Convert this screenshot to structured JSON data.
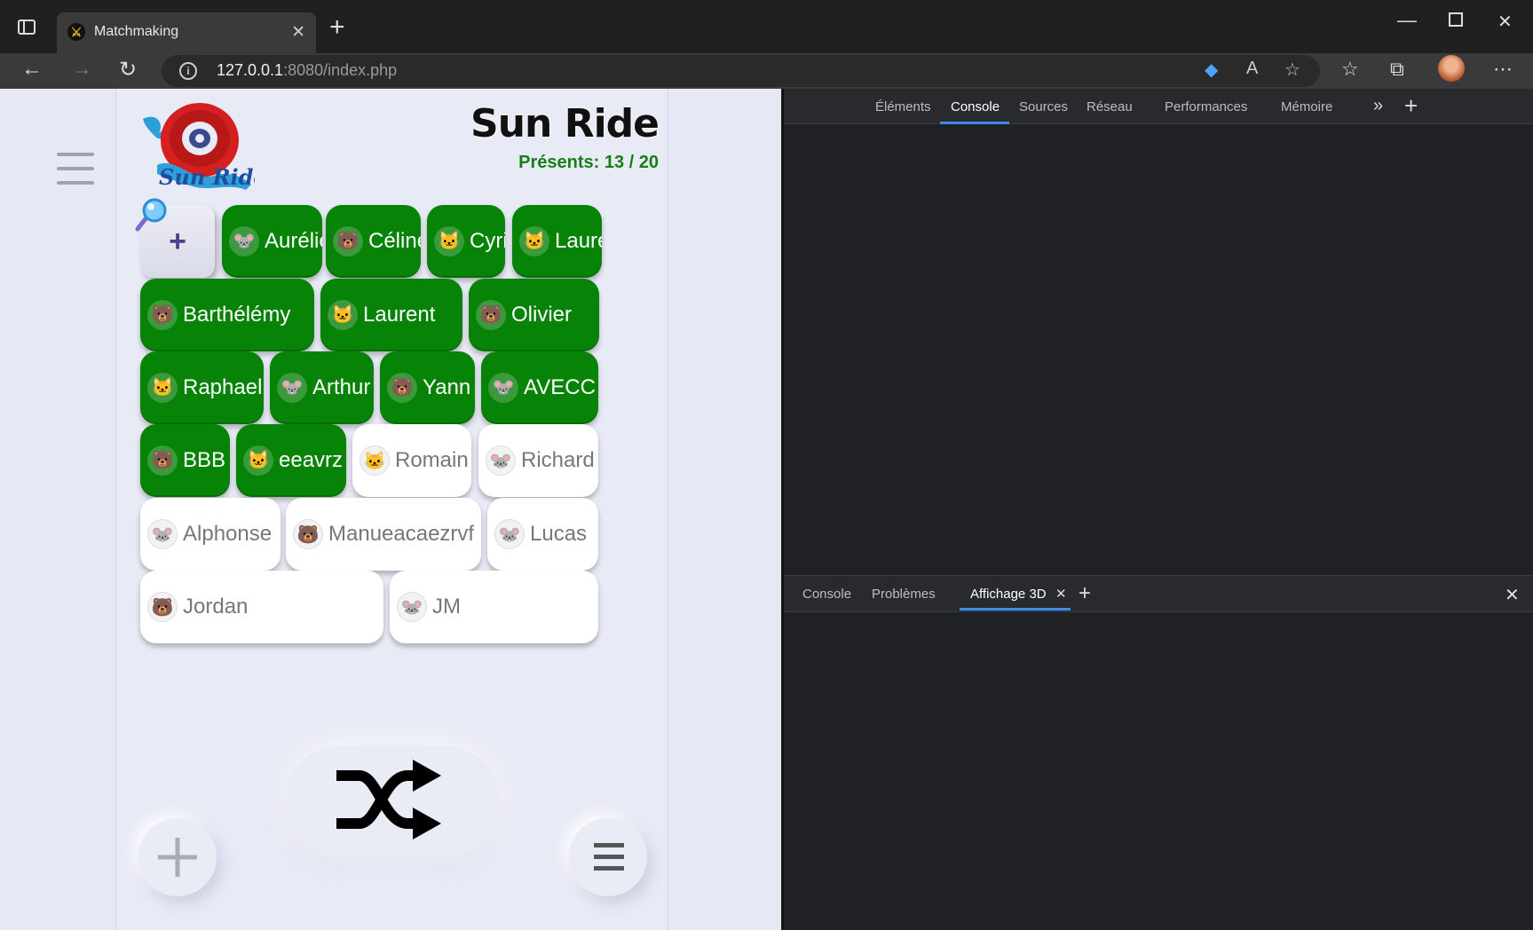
{
  "browser": {
    "tab_title": "Matchmaking",
    "url_host": "127.0.0.1",
    "url_rest": ":8080/index.php"
  },
  "app": {
    "brand": "Sun Ride",
    "present_label": "Présents: 13 / 20",
    "add_label": "+",
    "members": [
      {
        "name": "Aurélie",
        "icon": "mouse",
        "emoji": "🐭",
        "present": true
      },
      {
        "name": "Céline",
        "icon": "bear",
        "emoji": "🐻",
        "present": true
      },
      {
        "name": "Cyril",
        "icon": "cat",
        "emoji": "🐱",
        "present": true
      },
      {
        "name": "Laure",
        "icon": "cat",
        "emoji": "🐱",
        "present": true
      },
      {
        "name": "Barthélémy",
        "icon": "bear",
        "emoji": "🐻",
        "present": true
      },
      {
        "name": "Laurent",
        "icon": "cat",
        "emoji": "🐱",
        "present": true
      },
      {
        "name": "Olivier",
        "icon": "bear",
        "emoji": "🐻",
        "present": true
      },
      {
        "name": "Raphael",
        "icon": "cat",
        "emoji": "🐱",
        "present": true
      },
      {
        "name": "Arthur",
        "icon": "mouse",
        "emoji": "🐭",
        "present": true
      },
      {
        "name": "Yann",
        "icon": "bear",
        "emoji": "🐻",
        "present": true
      },
      {
        "name": "AVECC",
        "icon": "mouse",
        "emoji": "🐭",
        "present": true
      },
      {
        "name": "BBB",
        "icon": "bear",
        "emoji": "🐻",
        "present": true
      },
      {
        "name": "eeavrz",
        "icon": "cat",
        "emoji": "🐱",
        "present": true
      },
      {
        "name": "Romain",
        "icon": "cat",
        "emoji": "🐱",
        "present": false
      },
      {
        "name": "Richard",
        "icon": "mouse",
        "emoji": "🐭",
        "present": false
      },
      {
        "name": "Alphonse",
        "icon": "mouse",
        "emoji": "🐭",
        "present": false
      },
      {
        "name": "Manueacaezrvf",
        "icon": "bear",
        "emoji": "🐻",
        "present": false
      },
      {
        "name": "Lucas",
        "icon": "mouse",
        "emoji": "🐭",
        "present": false
      },
      {
        "name": "Jordan",
        "icon": "bear",
        "emoji": "🐻",
        "present": false
      },
      {
        "name": "JM",
        "icon": "mouse",
        "emoji": "🐭",
        "present": false
      }
    ],
    "colors": {
      "present": "#078307",
      "absent": "#ffffff",
      "brand_text": "#111111",
      "count_text": "#158015"
    }
  },
  "devtools": {
    "tabs": [
      "Éléments",
      "Console",
      "Sources",
      "Réseau",
      "Performances",
      "Mémoire"
    ],
    "active_tab": "Console",
    "drawer_tabs": [
      "Console",
      "Problèmes",
      "Affichage 3D"
    ],
    "active_drawer_tab": "Affichage 3D"
  }
}
